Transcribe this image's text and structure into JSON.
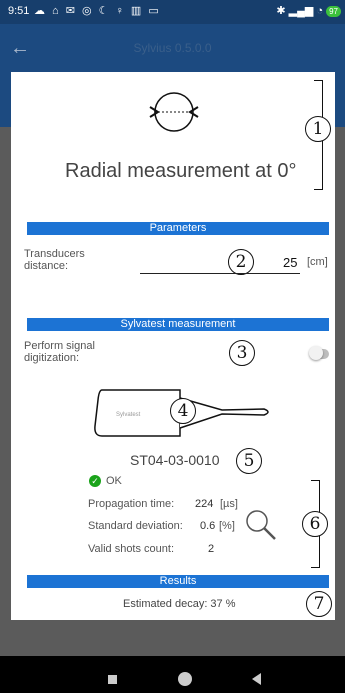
{
  "status_bar": {
    "time": "9:51",
    "battery": "97"
  },
  "app_bar": {
    "title": "Sylvius 0.5.0.0"
  },
  "header": {
    "title": "Radial measurement at 0°",
    "marker": "1"
  },
  "parameters": {
    "section_title": "Parameters",
    "transducers_label": "Transducers distance:",
    "transducers_value": "25",
    "transducers_unit": "[cm]",
    "marker": "2"
  },
  "measurement": {
    "section_title": "Sylvatest measurement",
    "digitization_label": "Perform signal digitization:",
    "digitization_enabled": false,
    "digitization_marker": "3",
    "probe_brand": "Sylvatest",
    "probe_marker": "4",
    "device_id": "ST04-03-0010",
    "device_marker": "5",
    "status_text": "OK",
    "propagation_label": "Propagation time:",
    "propagation_value": "224",
    "propagation_unit": "[µs]",
    "deviation_label": "Standard deviation:",
    "deviation_value": "0.6",
    "deviation_unit": "[%]",
    "shots_label": "Valid shots count:",
    "shots_value": "2",
    "stats_marker": "6"
  },
  "results": {
    "section_title": "Results",
    "decay_text": "Estimated decay: 37 %",
    "marker": "7"
  },
  "colors": {
    "primary": "#1c4a80",
    "section": "#1c73d4",
    "ok": "#1aa31a"
  }
}
